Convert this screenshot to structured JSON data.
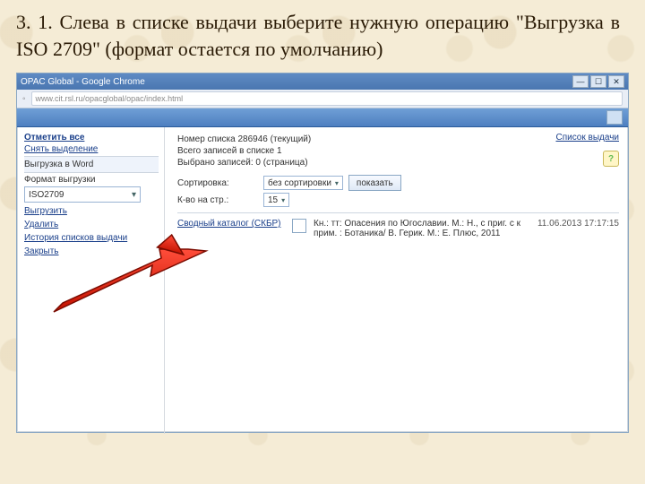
{
  "instruction": "3. 1. Слева в списке выдачи выберите нужную операцию \"Выгрузка в ISO 2709\" (формат остается по умолчанию)",
  "chrome": {
    "title": "OPAC Global - Google Chrome",
    "url": "www.cit.rsl.ru/opacglobal/opac/index.html",
    "btn_min": "—",
    "btn_max": "☐",
    "btn_close": "✕"
  },
  "topright_link": "Список выдачи",
  "help_icon": "?",
  "sidebar": {
    "mark_all": "Отметить все",
    "unmark": "Снять выделение",
    "export_word": "Выгрузка в Word",
    "format_label": "Формат выгрузки",
    "format_value": "ISO2709",
    "export_btn": "Выгрузить",
    "delete": "Удалить",
    "history": "История списков выдачи",
    "close": "Закрыть"
  },
  "content": {
    "line1": "Номер списка 286946 (текущий)",
    "line2": "Всего записей в списке 1",
    "line3": "Выбрано записей: 0 (страница)",
    "sort_label": "Сортировка:",
    "sort_value": "без сортировки",
    "show_btn": "показать",
    "perpage_label": "К-во на стр.:",
    "perpage_value": "15",
    "catalog_label": "Сводный каталог (СКБР)",
    "rec_text": "Кн.: тт: Опасения по Югославии. М.: Н., с приг. с к прим. : Ботаника/ В. Герик. М.: Е. Плюс, 2011",
    "rec_date": "11.06.2013   17:17:15"
  }
}
